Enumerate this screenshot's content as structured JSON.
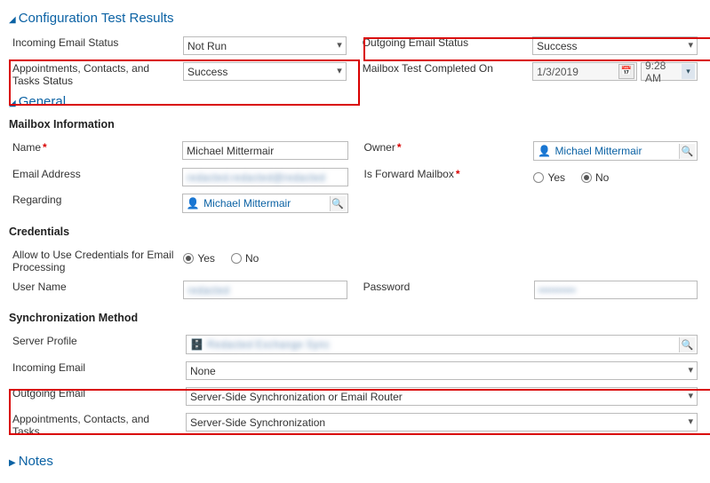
{
  "sections": {
    "config_title": "Configuration Test Results",
    "general_title": "General",
    "notes_title": "Notes"
  },
  "config": {
    "incoming_label": "Incoming Email Status",
    "incoming_value": "Not Run",
    "appt_label": "Appointments, Contacts, and Tasks Status",
    "appt_value": "Success",
    "outgoing_label": "Outgoing Email Status",
    "outgoing_value": "Success",
    "completed_label": "Mailbox Test Completed On",
    "completed_date": "1/3/2019",
    "completed_time": "9:28 AM"
  },
  "mailbox_info_head": "Mailbox Information",
  "mailbox": {
    "name_label": "Name",
    "name_value": "Michael Mittermair",
    "email_label": "Email Address",
    "email_value": "redacted.redacted@redacted",
    "regarding_label": "Regarding",
    "regarding_value": "Michael Mittermair",
    "owner_label": "Owner",
    "owner_value": "Michael Mittermair",
    "forward_label": "Is Forward Mailbox",
    "forward_yes": "Yes",
    "forward_no": "No",
    "forward_selected": "No"
  },
  "credentials_head": "Credentials",
  "credentials": {
    "allow_label": "Allow to Use Credentials for Email Processing",
    "allow_yes": "Yes",
    "allow_no": "No",
    "allow_selected": "Yes",
    "username_label": "User Name",
    "username_value": "redacted",
    "password_label": "Password",
    "password_value": "••••••••••"
  },
  "sync_head": "Synchronization Method",
  "sync": {
    "server_profile_label": "Server Profile",
    "server_profile_value": "Redacted Exchange Sync",
    "incoming_label": "Incoming Email",
    "incoming_value": "None",
    "outgoing_label": "Outgoing Email",
    "outgoing_value": "Server-Side Synchronization or Email Router",
    "appt_label": "Appointments, Contacts, and Tasks",
    "appt_value": "Server-Side Synchronization"
  }
}
